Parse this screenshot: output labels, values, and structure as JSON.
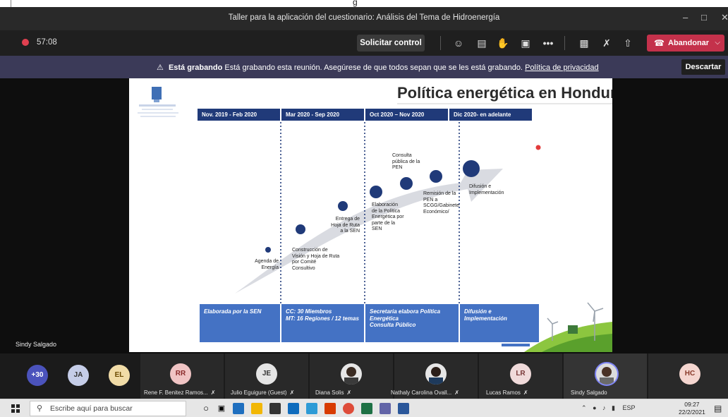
{
  "window": {
    "title": "Taller para la aplicación del cuestionario: Análisis del Tema de Hidroenergía",
    "cropped_top_text": "g"
  },
  "toolbar": {
    "timer": "57:08",
    "request_control": "Solicitar control",
    "leave": "Abandonar"
  },
  "banner": {
    "strong": "Está grabando",
    "message": "Está grabando esta reunión. Asegúrese de que todos sepan que se les está grabando.",
    "link": "Política de privacidad",
    "dismiss": "Descartar"
  },
  "stage": {
    "presenter": "Sindy Salgado"
  },
  "slide": {
    "title": "Política energética en Honduras",
    "periods": [
      "Nov. 2019 - Feb 2020",
      "Mar 2020 - Sep 2020",
      "Oct 2020 – Nov 2020",
      "Dic 2020- en adelante"
    ],
    "milestones": [
      "Agenda de Energía",
      "Construcción de Visión y Hoja de Ruta por Comité Consultivo",
      "Entrega de Hoja de Ruta a la SEN",
      "Elaboración de la Política Energética por parte de la SEN",
      "Consulta pública de la PEN",
      "Remisión de la PEN a SCGG/Gabinete Económico/",
      "Difusión e Implementación"
    ],
    "bottom_boxes": [
      "Elaborada por la SEN",
      "CC: 30 Miembros\nMT: 16 Regiones / 12 temas",
      "Secretaria elabora Política Energética\nConsulta Público",
      "Difusión e Implementación"
    ]
  },
  "participants": {
    "overflow": "+30",
    "tiles": [
      {
        "initials": "JA",
        "name": ""
      },
      {
        "initials": "EL",
        "name": ""
      },
      {
        "initials": "RR",
        "name": "Rene F. Benitez Ramos..."
      },
      {
        "initials": "JE",
        "name": "Julio Eguigure (Guest)"
      },
      {
        "initials": "",
        "name": "Diana Solis"
      },
      {
        "initials": "",
        "name": "Nathaly Carolina Ovall..."
      },
      {
        "initials": "LR",
        "name": "Lucas Ramos"
      },
      {
        "initials": "",
        "name": "Sindy Salgado"
      },
      {
        "initials": "HC",
        "name": ""
      }
    ]
  },
  "taskbar": {
    "search_placeholder": "Escribe aquí para buscar",
    "language": "ESP",
    "time": "09:27",
    "date": "22/2/2021"
  },
  "colors": {
    "leave_red": "#c4314b",
    "banner_purple": "#3b3a58",
    "slide_navy": "#203a79",
    "slide_blue": "#4472c4"
  }
}
